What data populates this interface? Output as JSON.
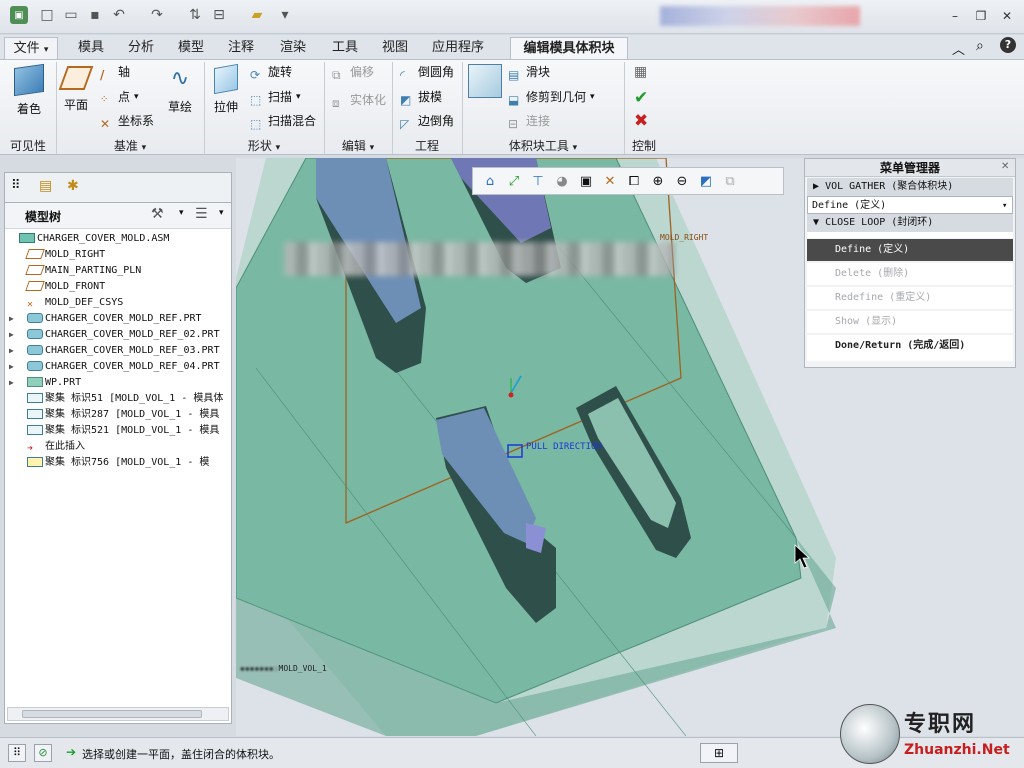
{
  "ribbon_tabs": {
    "file": "文件",
    "items": [
      "模具",
      "分析",
      "模型",
      "注释",
      "渲染",
      "工具",
      "视图",
      "应用程序"
    ],
    "active": "编辑模具体积块"
  },
  "ribbon": {
    "visibility": {
      "shading": "着色",
      "group": "可见性"
    },
    "datum": {
      "plane": "平面",
      "axis": "轴",
      "point": "点",
      "csys": "坐标系",
      "sketch": "草绘",
      "group": "基准"
    },
    "shapes": {
      "extrude": "拉伸",
      "revolve": "旋转",
      "sweep": "扫描",
      "swept_blend": "扫描混合",
      "group": "形状"
    },
    "editing": {
      "offset": "偏移",
      "solidify": "实体化",
      "group": "编辑"
    },
    "engineering": {
      "round": "倒圆角",
      "draft": "拔模",
      "chamfer": "边倒角",
      "group": "工程"
    },
    "volume_tools": {
      "slide": "滑块",
      "trim": "修剪到几何",
      "connect": "连接",
      "group": "体积块工具"
    },
    "control": {
      "group": "控制"
    }
  },
  "model_tree": {
    "title": "模型树",
    "items": [
      {
        "label": "CHARGER_COVER_MOLD.ASM",
        "icon": "assembly-icon",
        "indent": 0,
        "expander": ""
      },
      {
        "label": "MOLD_RIGHT",
        "icon": "datum-plane-icon",
        "indent": 1,
        "expander": ""
      },
      {
        "label": "MAIN_PARTING_PLN",
        "icon": "datum-plane-icon",
        "indent": 1,
        "expander": ""
      },
      {
        "label": "MOLD_FRONT",
        "icon": "datum-plane-icon",
        "indent": 1,
        "expander": ""
      },
      {
        "label": "MOLD_DEF_CSYS",
        "icon": "csys-icon",
        "indent": 1,
        "expander": ""
      },
      {
        "label": "CHARGER_COVER_MOLD_REF.PRT",
        "icon": "part-icon",
        "indent": 1,
        "expander": "▶"
      },
      {
        "label": "CHARGER_COVER_MOLD_REF_02.PRT",
        "icon": "part-icon",
        "indent": 1,
        "expander": "▶"
      },
      {
        "label": "CHARGER_COVER_MOLD_REF_03.PRT",
        "icon": "part-icon",
        "indent": 1,
        "expander": "▶"
      },
      {
        "label": "CHARGER_COVER_MOLD_REF_04.PRT",
        "icon": "part-icon",
        "indent": 1,
        "expander": "▶"
      },
      {
        "label": "WP.PRT",
        "icon": "workpiece-icon",
        "indent": 1,
        "expander": "▶"
      },
      {
        "label": "聚集 标识51 [MOLD_VOL_1 - 模具体",
        "icon": "gather-icon",
        "indent": 1,
        "expander": ""
      },
      {
        "label": "聚集 标识287 [MOLD_VOL_1 - 模具",
        "icon": "gather-icon",
        "indent": 1,
        "expander": ""
      },
      {
        "label": "聚集 标识521 [MOLD_VOL_1 - 模具",
        "icon": "gather-icon",
        "indent": 1,
        "expander": ""
      },
      {
        "label": "在此插入",
        "icon": "insert-arrow-icon",
        "indent": 1,
        "expander": ""
      },
      {
        "label": "聚集 标识756 [MOLD_VOL_1 - 模",
        "icon": "gather-active-icon",
        "indent": 1,
        "expander": ""
      }
    ]
  },
  "viewport": {
    "label_mold_right": "MOLD_RIGHT",
    "label_pull_direction": "PULL DIRECTION",
    "label_volume": "MOLD_VOL_1"
  },
  "menu_manager": {
    "title": "菜单管理器",
    "vol_gather": "VOL GATHER (聚合体积块)",
    "define_row": "Define (定义)",
    "close_loop": "CLOSE LOOP (封闭环)",
    "items": [
      {
        "label": "Define (定义)",
        "state": "selected"
      },
      {
        "label": "Delete (删除)",
        "state": "disabled"
      },
      {
        "label": "Redefine (重定义)",
        "state": "disabled"
      },
      {
        "label": "Show (显示)",
        "state": "disabled"
      },
      {
        "label": "Done/Return (完成/返回)",
        "state": "bold"
      }
    ]
  },
  "status": {
    "message": "选择或创建一平面，盖住闭合的体积块。"
  },
  "watermark": {
    "cn": "专职网",
    "url": "Zhuanzhi.Net"
  },
  "colors": {
    "mold_green": "#7fbfa8",
    "part_blue": "#6f8fb8",
    "dark_part": "#2f4f4a",
    "selected_bg": "#4a4a4a",
    "datum_brown": "#a0621f"
  }
}
